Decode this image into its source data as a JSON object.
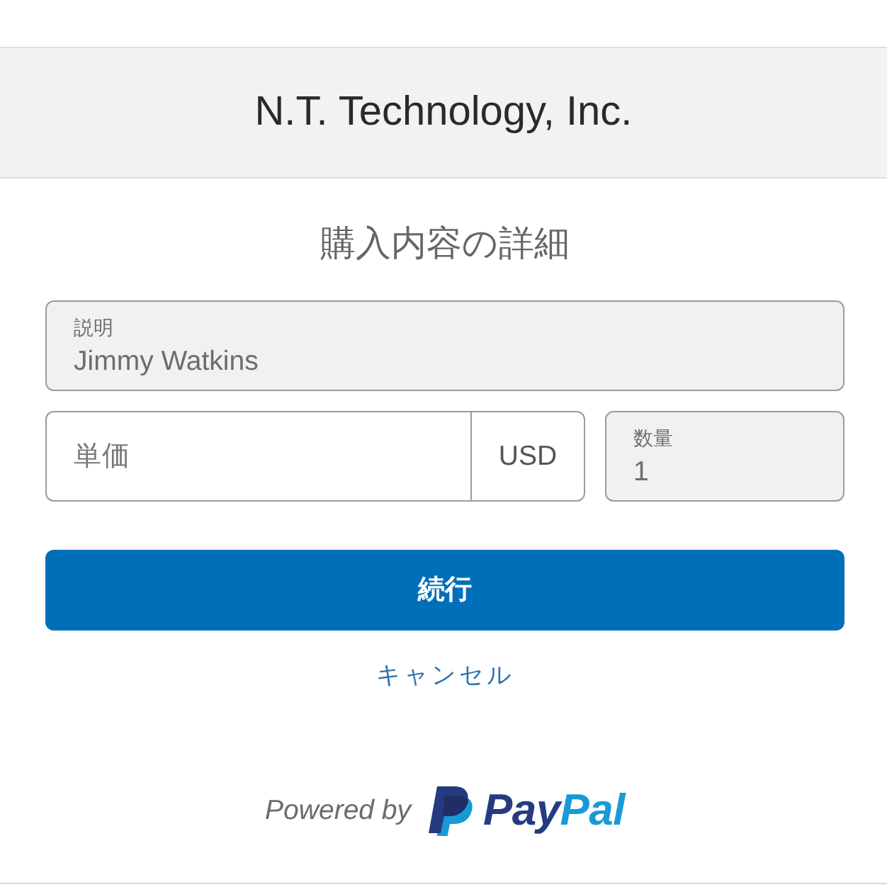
{
  "merchant": {
    "name": "N.T. Technology, Inc."
  },
  "heading": "購入内容の詳細",
  "description": {
    "label": "説明",
    "value": "Jimmy Watkins",
    "disabled": true
  },
  "price": {
    "placeholder": "単価",
    "currency": "USD",
    "disabled": false
  },
  "quantity": {
    "label": "数量",
    "value": "1",
    "disabled": true
  },
  "continue_button": {
    "label": "続行"
  },
  "cancel_link": {
    "label": "キャンセル"
  },
  "footer": {
    "powered_by": "Powered by",
    "logo": [
      {
        "text": "Pay",
        "color": "#253b80"
      },
      {
        "text": "Pal",
        "color": "#179bd7"
      }
    ]
  }
}
